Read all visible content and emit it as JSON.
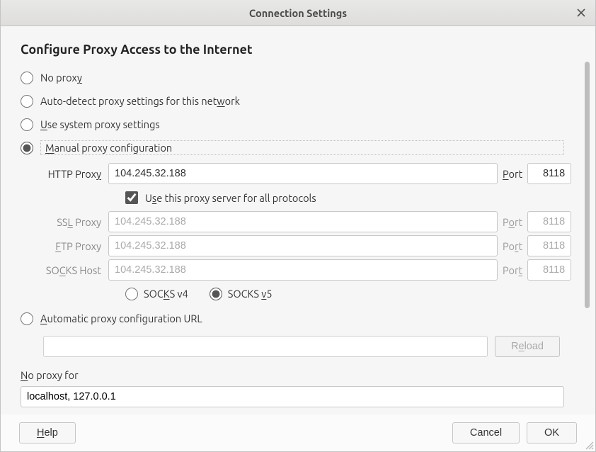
{
  "window": {
    "title": "Connection Settings"
  },
  "heading": "Configure Proxy Access to the Internet",
  "proxy_mode_labels": {
    "none_pre": "No prox",
    "none_u": "y",
    "none_post": "",
    "auto_pre": "Auto-detect proxy settings for this net",
    "auto_u": "w",
    "auto_post": "ork",
    "system_u": "U",
    "system_post": "se system proxy settings",
    "manual_u": "M",
    "manual_post": "anual proxy configuration",
    "pac_u": "A",
    "pac_post": "utomatic proxy configuration URL"
  },
  "http": {
    "label_pre": "HTTP Prox",
    "label_u": "y",
    "value": "104.245.32.188",
    "port_label_u": "P",
    "port_label_post": "ort",
    "port": "8118"
  },
  "share": {
    "label_pre": "U",
    "label_u": "s",
    "label_post": "e this proxy server for all protocols"
  },
  "ssl": {
    "label_pre": "SS",
    "label_u": "L",
    "label_post": " Proxy",
    "value": "104.245.32.188",
    "port_label_pre": "P",
    "port_label_u": "o",
    "port_label_post": "rt",
    "port": "8118"
  },
  "ftp": {
    "label_u": "F",
    "label_post": "TP Proxy",
    "value": "104.245.32.188",
    "port_label_pre": "Po",
    "port_label_u": "r",
    "port_label_post": "t",
    "port": "8118"
  },
  "socks": {
    "label_pre": "SO",
    "label_u": "C",
    "label_post": "KS Host",
    "value": "104.245.32.188",
    "port_label_pre": "Por",
    "port_label_u": "t",
    "port": "8118",
    "v4_pre": "SOC",
    "v4_u": "K",
    "v4_post": "S v4",
    "v5_pre": "SOCKS ",
    "v5_u": "v",
    "v5_post": "5"
  },
  "reload": {
    "label_pre": "R",
    "label_u": "e",
    "label_post": "load"
  },
  "noproxy": {
    "label_u": "N",
    "label_post": "o proxy for",
    "value": "localhost, 127.0.0.1"
  },
  "footer": {
    "help_u": "H",
    "help_post": "elp",
    "cancel": "Cancel",
    "ok": "OK"
  }
}
